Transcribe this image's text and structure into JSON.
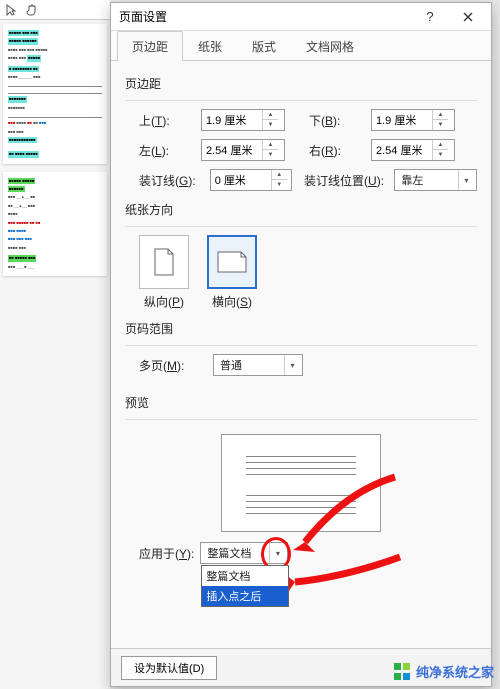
{
  "dialog": {
    "title": "页面设置",
    "tabs": [
      "页边距",
      "纸张",
      "版式",
      "文档网格"
    ],
    "active_tab": 0
  },
  "margins": {
    "section": "页边距",
    "top_label": "上(T):",
    "top_value": "1.9 厘米",
    "bottom_label": "下(B):",
    "bottom_value": "1.9 厘米",
    "left_label": "左(L):",
    "left_value": "2.54 厘米",
    "right_label": "右(R):",
    "right_value": "2.54 厘米",
    "gutter_label": "装订线(G):",
    "gutter_value": "0 厘米",
    "gutter_pos_label": "装订线位置(U):",
    "gutter_pos_value": "靠左"
  },
  "orientation": {
    "section": "纸张方向",
    "portrait": "纵向(P)",
    "landscape": "横向(S)",
    "selected": "landscape"
  },
  "pages": {
    "section": "页码范围",
    "multi_label": "多页(M):",
    "multi_value": "普通"
  },
  "preview": {
    "section": "预览"
  },
  "apply": {
    "label": "应用于(Y):",
    "value": "整篇文档",
    "options": [
      "整篇文档",
      "插入点之后"
    ],
    "selected_option": 1
  },
  "footer": {
    "default_btn": "设为默认值(D)"
  },
  "watermark": "纯净系统之家"
}
